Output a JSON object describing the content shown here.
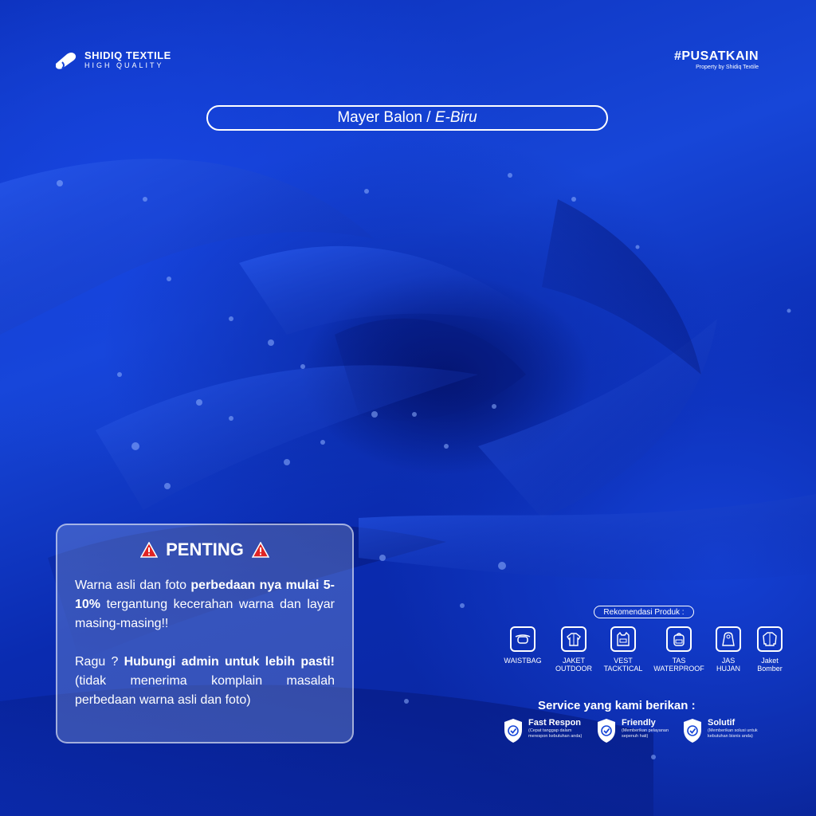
{
  "brand": {
    "name": "SHIDIQ TEXTILE",
    "tagline": "HIGH QUALITY"
  },
  "hashtag": {
    "tag": "#PUSATKAIN",
    "property": "Property by Shidiq Textile"
  },
  "product": {
    "name": "Mayer Balon",
    "separator": "/",
    "color_variant": "E-Biru"
  },
  "notice": {
    "title": "PENTING",
    "p1_a": "Warna asli dan foto ",
    "p1_b": "perbedaan nya mulai 5-10%",
    "p1_c": " tergantung kecerahan warna dan layar masing-masing!!",
    "p2_a": "Ragu ? ",
    "p2_b": "Hubungi admin untuk lebih pasti!",
    "p2_c": " (tidak menerima komplain masalah perbedaan warna asli dan foto)"
  },
  "recommendation": {
    "label": "Rekomendasi Produk :",
    "items": [
      {
        "line1": "WAISTBAG",
        "line2": "",
        "icon": "waistbag-icon"
      },
      {
        "line1": "JAKET",
        "line2": "OUTDOOR",
        "icon": "jacket-icon"
      },
      {
        "line1": "VEST",
        "line2": "TACKTICAL",
        "icon": "vest-icon"
      },
      {
        "line1": "TAS",
        "line2": "WATERPROOF",
        "icon": "backpack-icon"
      },
      {
        "line1": "JAS",
        "line2": "HUJAN",
        "icon": "raincoat-icon"
      },
      {
        "line1": "Jaket",
        "line2": "Bomber",
        "icon": "bomber-jacket-icon"
      }
    ]
  },
  "services": {
    "title": "Service yang kami berikan :",
    "items": [
      {
        "name": "Fast Respon",
        "desc1": "(Cepat tanggap dalam",
        "desc2": "merespon kebutuhan anda)"
      },
      {
        "name": "Friendly",
        "desc1": "(Memberikan pelayanan",
        "desc2": "sepenuh hati)"
      },
      {
        "name": "Solutif",
        "desc1": "(Memberikan solusi untuk",
        "desc2": "kebutuhan bisnis anda)"
      }
    ]
  },
  "colors": {
    "fabric": "#1746d8",
    "fabric_dark": "#03126a",
    "text": "#ffffff",
    "warning": "#e02424"
  }
}
